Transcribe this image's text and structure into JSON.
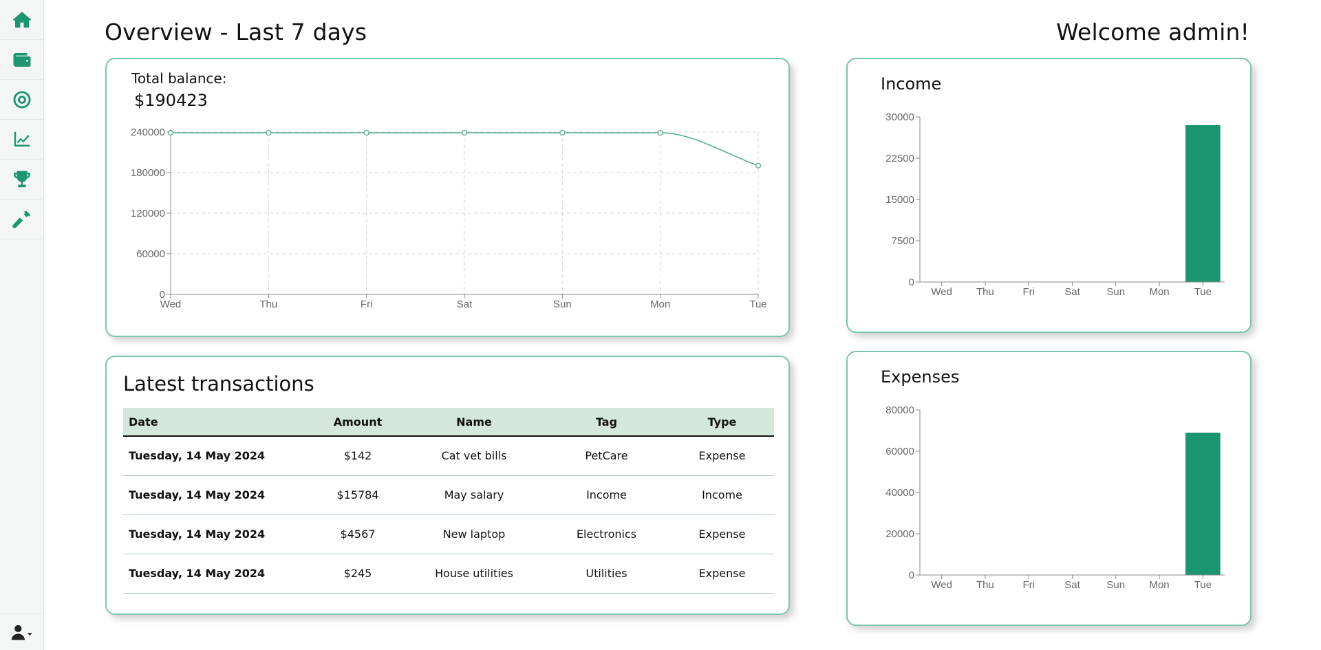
{
  "header": {
    "title": "Overview - Last 7 days",
    "welcome": "Welcome admin!"
  },
  "sidebar": {
    "items": [
      {
        "icon": "home-icon"
      },
      {
        "icon": "wallet-icon"
      },
      {
        "icon": "target-icon"
      },
      {
        "icon": "chart-line-icon"
      },
      {
        "icon": "trophy-icon"
      },
      {
        "icon": "hammer-icon"
      }
    ],
    "user_icon": "user-dropdown-icon"
  },
  "balance": {
    "label": "Total balance:",
    "value": "$190423"
  },
  "transactions": {
    "title": "Latest transactions",
    "columns": [
      "Date",
      "Amount",
      "Name",
      "Tag",
      "Type"
    ],
    "rows": [
      [
        "Tuesday, 14 May 2024",
        "$142",
        "Cat vet bills",
        "PetCare",
        "Expense"
      ],
      [
        "Tuesday, 14 May 2024",
        "$15784",
        "May salary",
        "Income",
        "Income"
      ],
      [
        "Tuesday, 14 May 2024",
        "$4567",
        "New laptop",
        "Electronics",
        "Expense"
      ],
      [
        "Tuesday, 14 May 2024",
        "$245",
        "House utilities",
        "Utilities",
        "Expense"
      ]
    ]
  },
  "income": {
    "title": "Income"
  },
  "expenses": {
    "title": "Expenses"
  },
  "colors": {
    "accent": "#1c9670",
    "card_border": "#7cc5ac",
    "table_header": "#d3e7dd",
    "line": "#4eab8c"
  },
  "chart_data": [
    {
      "type": "line",
      "x": [
        "Wed",
        "Thu",
        "Fri",
        "Sat",
        "Sun",
        "Mon",
        "Tue"
      ],
      "values": [
        239000,
        239000,
        239000,
        239000,
        239000,
        239000,
        190423
      ],
      "ylim": [
        0,
        240000
      ],
      "yticks": [
        0,
        60000,
        120000,
        180000,
        240000
      ],
      "grid": true
    },
    {
      "type": "bar",
      "title": "Income",
      "categories": [
        "Wed",
        "Thu",
        "Fri",
        "Sat",
        "Sun",
        "Mon",
        "Tue"
      ],
      "values": [
        0,
        0,
        0,
        0,
        0,
        0,
        28500
      ],
      "ylim": [
        0,
        30000
      ],
      "yticks": [
        0,
        7500,
        15000,
        22500,
        30000
      ],
      "color": "#1c9670"
    },
    {
      "type": "bar",
      "title": "Expenses",
      "categories": [
        "Wed",
        "Thu",
        "Fri",
        "Sat",
        "Sun",
        "Mon",
        "Tue"
      ],
      "values": [
        0,
        0,
        0,
        0,
        0,
        0,
        69000
      ],
      "ylim": [
        0,
        80000
      ],
      "yticks": [
        0,
        20000,
        40000,
        60000,
        80000
      ],
      "color": "#1c9670"
    }
  ]
}
